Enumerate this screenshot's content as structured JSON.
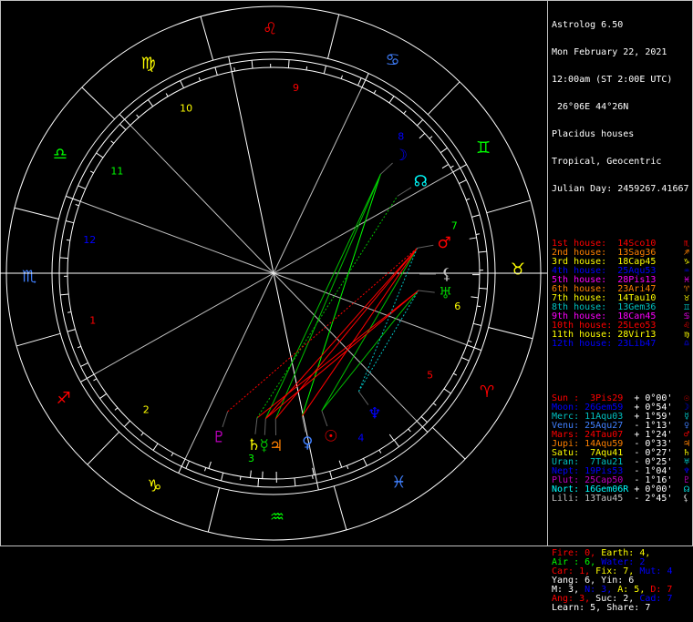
{
  "header": {
    "app": "Astrolog 6.50",
    "date": "Mon February 22, 2021",
    "time": "12:00am (ST 2:00E UTC)",
    "location": " 26°06E 44°26N",
    "house_system": "Placidus houses",
    "zodiac": "Tropical, Geocentric",
    "julian": "Julian Day: 2459267.41667"
  },
  "colors": {
    "red": "#ff0000",
    "orange": "#ff8000",
    "yellow": "#ffff00",
    "green": "#00c000",
    "ltgreen": "#00ff00",
    "cyan": "#00c0c0",
    "blue": "#0000ff",
    "purple": "#c000c0",
    "magenta": "#ff00ff",
    "white": "#ffffff",
    "gray": "#c0c0c0",
    "ltcyan": "#00ffff",
    "maroon": "#c00000",
    "ltblue": "#4080ff"
  },
  "houses": [
    {
      "label": "1st house:",
      "value": "14Sco10",
      "color": "red",
      "sign": "♏"
    },
    {
      "label": "2nd house:",
      "value": "13Sag36",
      "color": "orange",
      "sign": "♐"
    },
    {
      "label": "3rd house:",
      "value": "18Cap45",
      "color": "yellow",
      "sign": "♑"
    },
    {
      "label": "4th house:",
      "value": "25Aqu53",
      "color": "blue",
      "sign": "♒"
    },
    {
      "label": "5th house:",
      "value": "28Pis13",
      "color": "magenta",
      "sign": "♓"
    },
    {
      "label": "6th house:",
      "value": "23Ari47",
      "color": "orange",
      "sign": "♈"
    },
    {
      "label": "7th house:",
      "value": "14Tau10",
      "color": "yellow",
      "sign": "♉"
    },
    {
      "label": "8th house:",
      "value": "13Gem36",
      "color": "cyan",
      "sign": "♊"
    },
    {
      "label": "9th house:",
      "value": "18Can45",
      "color": "magenta",
      "sign": "♋"
    },
    {
      "label": "10th house:",
      "value": "25Leo53",
      "color": "red",
      "sign": "♌"
    },
    {
      "label": "11th house:",
      "value": "28Vir13",
      "color": "yellow",
      "sign": "♍"
    },
    {
      "label": "12th house:",
      "value": "23Lib47",
      "color": "blue",
      "sign": "♎"
    }
  ],
  "planets": [
    {
      "label": "Sun :",
      "value": " 3Pis29",
      "motion": "+ 0°00'",
      "color": "red",
      "sym": "☉"
    },
    {
      "label": "Moon:",
      "value": "26Gem59",
      "motion": "+ 0°54'",
      "color": "blue",
      "sym": "☽"
    },
    {
      "label": "Merc:",
      "value": "11Aqu03",
      "motion": "+ 1°59'",
      "color": "cyan",
      "sym": "☿"
    },
    {
      "label": "Venu:",
      "value": "25Aqu27",
      "motion": "- 1°13'",
      "color": "ltblue",
      "sym": "♀"
    },
    {
      "label": "Mars:",
      "value": "24Tau07",
      "motion": "+ 1°24'",
      "color": "red",
      "sym": "♂"
    },
    {
      "label": "Jupi:",
      "value": "14Aqu59",
      "motion": "- 0°33'",
      "color": "orange",
      "sym": "♃"
    },
    {
      "label": "Satu:",
      "value": " 7Aqu41",
      "motion": "- 0°27'",
      "color": "yellow",
      "sym": "♄"
    },
    {
      "label": "Uran:",
      "value": " 7Tau21",
      "motion": "- 0°25'",
      "color": "cyan",
      "sym": "♅"
    },
    {
      "label": "Nept:",
      "value": "19Pis53",
      "motion": "- 1°04'",
      "color": "blue",
      "sym": "♆"
    },
    {
      "label": "Plut:",
      "value": "25Cap50",
      "motion": "- 1°16'",
      "color": "purple",
      "sym": "♇"
    },
    {
      "label": "Nort:",
      "value": "16Gem06R",
      "motion": "+ 0°00'",
      "color": "ltcyan",
      "sym": "☊"
    },
    {
      "label": "Lili:",
      "value": "13Tau45",
      "motion": "- 2°45'",
      "color": "gray",
      "sym": "⚸"
    }
  ],
  "stats": [
    [
      {
        "t": "Fire: 0, ",
        "c": "red"
      },
      {
        "t": "Earth: 4,",
        "c": "yellow"
      }
    ],
    [
      {
        "t": "Air : 6, ",
        "c": "ltgreen"
      },
      {
        "t": "Water: 2",
        "c": "blue"
      }
    ],
    [
      {
        "t": "Car: 1, ",
        "c": "red"
      },
      {
        "t": "Fix: 7, ",
        "c": "yellow"
      },
      {
        "t": "Mut: 4",
        "c": "blue"
      }
    ],
    [
      {
        "t": "Yang: 6, Yin: 6",
        "c": "white"
      }
    ],
    [
      {
        "t": "M: 3, ",
        "c": "white"
      },
      {
        "t": "N: 3, ",
        "c": "blue"
      },
      {
        "t": "A: 5, ",
        "c": "yellow"
      },
      {
        "t": "D: 7",
        "c": "red"
      }
    ],
    [
      {
        "t": "Ang: 3, ",
        "c": "red"
      },
      {
        "t": "Suc: 2, ",
        "c": "white"
      },
      {
        "t": "Cad: 7",
        "c": "blue"
      }
    ],
    [
      {
        "t": "Learn: 5, Share: 7",
        "c": "white"
      }
    ]
  ],
  "chart_data": {
    "type": "astrological-wheel",
    "ascendant": "14Sco10",
    "zodiac_signs": [
      {
        "sym": "♈",
        "color": "red"
      },
      {
        "sym": "♉",
        "color": "yellow"
      },
      {
        "sym": "♊",
        "color": "ltgreen"
      },
      {
        "sym": "♋",
        "color": "ltblue"
      },
      {
        "sym": "♌",
        "color": "red"
      },
      {
        "sym": "♍",
        "color": "yellow"
      },
      {
        "sym": "♎",
        "color": "ltgreen"
      },
      {
        "sym": "♏",
        "color": "ltblue"
      },
      {
        "sym": "♐",
        "color": "red"
      },
      {
        "sym": "♑",
        "color": "yellow"
      },
      {
        "sym": "♒",
        "color": "ltgreen"
      },
      {
        "sym": "♓",
        "color": "ltblue"
      }
    ],
    "house_numbers": [
      {
        "n": "1",
        "color": "red"
      },
      {
        "n": "2",
        "color": "yellow"
      },
      {
        "n": "3",
        "color": "ltgreen"
      },
      {
        "n": "4",
        "color": "blue"
      },
      {
        "n": "5",
        "color": "red"
      },
      {
        "n": "6",
        "color": "yellow"
      },
      {
        "n": "7",
        "color": "ltgreen"
      },
      {
        "n": "8",
        "color": "blue"
      },
      {
        "n": "9",
        "color": "red"
      },
      {
        "n": "10",
        "color": "yellow"
      },
      {
        "n": "11",
        "color": "ltgreen"
      },
      {
        "n": "12",
        "color": "blue"
      }
    ],
    "house_cusps": [
      224.17,
      253.6,
      288.75,
      325.88,
      358.22,
      23.78,
      44.17,
      73.6,
      108.75,
      145.88,
      178.22,
      203.78
    ],
    "planet_positions": [
      {
        "sym": "☉",
        "lon": 333.48,
        "color": "red"
      },
      {
        "sym": "☽",
        "lon": 86.98,
        "color": "blue"
      },
      {
        "sym": "☿",
        "lon": 311.05,
        "color": "green"
      },
      {
        "sym": "♀",
        "lon": 325.45,
        "color": "ltblue"
      },
      {
        "sym": "♂",
        "lon": 54.12,
        "color": "red"
      },
      {
        "sym": "♃",
        "lon": 314.98,
        "color": "orange"
      },
      {
        "sym": "♄",
        "lon": 307.68,
        "color": "yellow"
      },
      {
        "sym": "♅",
        "lon": 37.35,
        "color": "green"
      },
      {
        "sym": "♆",
        "lon": 349.88,
        "color": "blue"
      },
      {
        "sym": "♇",
        "lon": 295.83,
        "color": "purple"
      },
      {
        "sym": "☊",
        "lon": 76.1,
        "color": "ltcyan"
      },
      {
        "sym": "⚸",
        "lon": 43.75,
        "color": "gray"
      }
    ],
    "aspects": [
      {
        "a": 0,
        "b": 4,
        "color": "green",
        "dash": false
      },
      {
        "a": 0,
        "b": 7,
        "color": "green",
        "dash": false
      },
      {
        "a": 1,
        "b": 2,
        "color": "green",
        "dash": false
      },
      {
        "a": 1,
        "b": 3,
        "color": "ltgreen",
        "dash": false
      },
      {
        "a": 1,
        "b": 5,
        "color": "green",
        "dash": false
      },
      {
        "a": 2,
        "b": 4,
        "color": "red",
        "dash": false
      },
      {
        "a": 2,
        "b": 7,
        "color": "red",
        "dash": false
      },
      {
        "a": 3,
        "b": 4,
        "color": "red",
        "dash": false
      },
      {
        "a": 5,
        "b": 4,
        "color": "red",
        "dash": false
      },
      {
        "a": 6,
        "b": 7,
        "color": "red",
        "dash": false
      },
      {
        "a": 8,
        "b": 4,
        "color": "cyan",
        "dash": true
      },
      {
        "a": 8,
        "b": 7,
        "color": "cyan",
        "dash": true
      },
      {
        "a": 6,
        "b": 10,
        "color": "green",
        "dash": true
      },
      {
        "a": 9,
        "b": 4,
        "color": "red",
        "dash": true
      }
    ]
  }
}
